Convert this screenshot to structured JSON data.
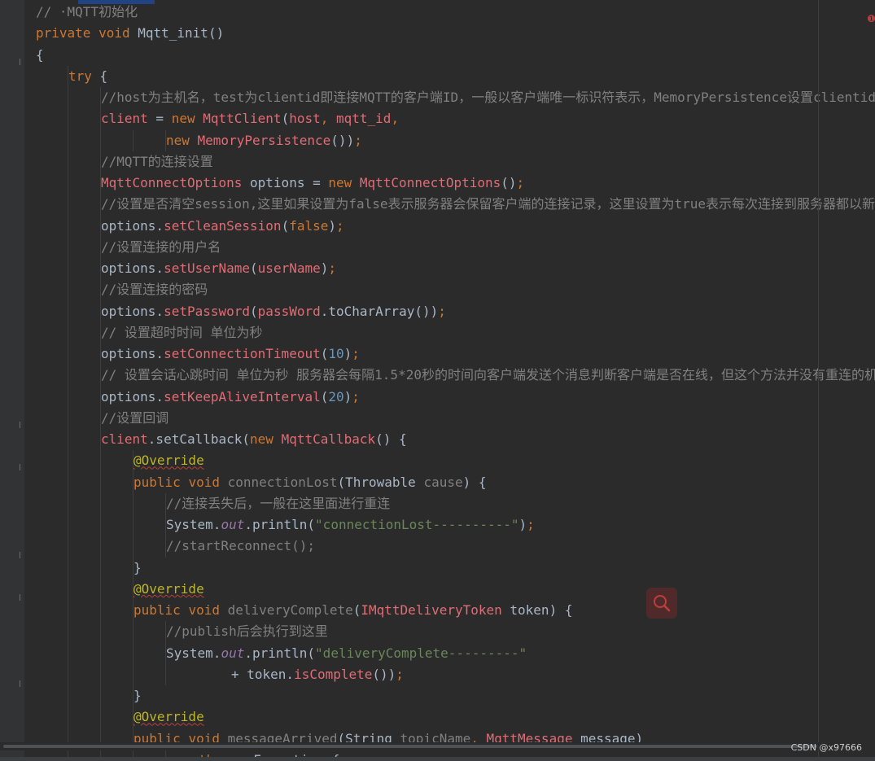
{
  "editor": {
    "lines": [
      {
        "indent": 0,
        "tokens": [
          {
            "t": "// ",
            "c": "comment"
          },
          {
            "t": "·MQTT初始化",
            "c": "comment"
          }
        ]
      },
      {
        "indent": 0,
        "tokens": [
          {
            "t": "private ",
            "c": "kw"
          },
          {
            "t": "void ",
            "c": "kw"
          },
          {
            "t": "Mqtt_init",
            "c": "plain"
          },
          {
            "t": "()",
            "c": "plain"
          }
        ]
      },
      {
        "indent": 0,
        "tokens": [
          {
            "t": "{",
            "c": "plain"
          }
        ]
      },
      {
        "indent": 1,
        "tokens": [
          {
            "t": "try ",
            "c": "kw"
          },
          {
            "t": "{",
            "c": "plain"
          }
        ]
      },
      {
        "indent": 2,
        "tokens": [
          {
            "t": "//host为主机名，test为clientid即连接MQTT的客户端ID，一般以客户端唯一标识符表示，MemoryPersistence设置clientid的保存形式，默认为以内存保存",
            "c": "comment"
          }
        ]
      },
      {
        "indent": 2,
        "tokens": [
          {
            "t": "client",
            "c": "type"
          },
          {
            "t": " = ",
            "c": "plain"
          },
          {
            "t": "new ",
            "c": "kw"
          },
          {
            "t": "MqttClient",
            "c": "type"
          },
          {
            "t": "(",
            "c": "plain"
          },
          {
            "t": "host",
            "c": "type"
          },
          {
            "t": ", ",
            "c": "kw"
          },
          {
            "t": "mqtt_id",
            "c": "type"
          },
          {
            "t": ",",
            "c": "kw"
          }
        ]
      },
      {
        "indent": 4,
        "tokens": [
          {
            "t": "new ",
            "c": "kw"
          },
          {
            "t": "MemoryPersistence",
            "c": "type"
          },
          {
            "t": "())",
            "c": "plain"
          },
          {
            "t": ";",
            "c": "kw"
          }
        ]
      },
      {
        "indent": 2,
        "tokens": [
          {
            "t": "//MQTT的连接设置",
            "c": "comment"
          }
        ]
      },
      {
        "indent": 2,
        "tokens": [
          {
            "t": "MqttConnectOptions",
            "c": "type"
          },
          {
            "t": " options = ",
            "c": "plain"
          },
          {
            "t": "new ",
            "c": "kw"
          },
          {
            "t": "MqttConnectOptions",
            "c": "type"
          },
          {
            "t": "()",
            "c": "plain"
          },
          {
            "t": ";",
            "c": "kw"
          }
        ]
      },
      {
        "indent": 2,
        "tokens": [
          {
            "t": "//设置是否清空session,这里如果设置为false表示服务器会保留客户端的连接记录，这里设置为true表示每次连接到服务器都以新的身份连接",
            "c": "comment"
          }
        ]
      },
      {
        "indent": 2,
        "tokens": [
          {
            "t": "options.",
            "c": "plain"
          },
          {
            "t": "setCleanSession",
            "c": "type"
          },
          {
            "t": "(",
            "c": "plain"
          },
          {
            "t": "false",
            "c": "kw"
          },
          {
            "t": ")",
            "c": "plain"
          },
          {
            "t": ";",
            "c": "kw"
          }
        ]
      },
      {
        "indent": 2,
        "tokens": [
          {
            "t": "//设置连接的用户名",
            "c": "comment"
          }
        ]
      },
      {
        "indent": 2,
        "tokens": [
          {
            "t": "options.",
            "c": "plain"
          },
          {
            "t": "setUserName",
            "c": "type"
          },
          {
            "t": "(",
            "c": "plain"
          },
          {
            "t": "userName",
            "c": "type"
          },
          {
            "t": ")",
            "c": "plain"
          },
          {
            "t": ";",
            "c": "kw"
          }
        ]
      },
      {
        "indent": 2,
        "tokens": [
          {
            "t": "//设置连接的密码",
            "c": "comment"
          }
        ]
      },
      {
        "indent": 2,
        "tokens": [
          {
            "t": "options.",
            "c": "plain"
          },
          {
            "t": "setPassword",
            "c": "type"
          },
          {
            "t": "(",
            "c": "plain"
          },
          {
            "t": "passWord",
            "c": "type"
          },
          {
            "t": ".toCharArray())",
            "c": "plain"
          },
          {
            "t": ";",
            "c": "kw"
          }
        ]
      },
      {
        "indent": 2,
        "tokens": [
          {
            "t": "// 设置超时时间 单位为秒",
            "c": "comment"
          }
        ]
      },
      {
        "indent": 2,
        "tokens": [
          {
            "t": "options.",
            "c": "plain"
          },
          {
            "t": "setConnectionTimeout",
            "c": "type"
          },
          {
            "t": "(",
            "c": "plain"
          },
          {
            "t": "10",
            "c": "number"
          },
          {
            "t": ")",
            "c": "plain"
          },
          {
            "t": ";",
            "c": "kw"
          }
        ]
      },
      {
        "indent": 2,
        "tokens": [
          {
            "t": "// 设置会话心跳时间 单位为秒 服务器会每隔1.5*20秒的时间向客户端发送个消息判断客户端是否在线，但这个方法并没有重连的机制",
            "c": "comment"
          }
        ]
      },
      {
        "indent": 2,
        "tokens": [
          {
            "t": "options.",
            "c": "plain"
          },
          {
            "t": "setKeepAliveInterval",
            "c": "type"
          },
          {
            "t": "(",
            "c": "plain"
          },
          {
            "t": "20",
            "c": "number"
          },
          {
            "t": ")",
            "c": "plain"
          },
          {
            "t": ";",
            "c": "kw"
          }
        ]
      },
      {
        "indent": 2,
        "tokens": [
          {
            "t": "//设置回调",
            "c": "comment"
          }
        ]
      },
      {
        "indent": 2,
        "tokens": [
          {
            "t": "client",
            "c": "type"
          },
          {
            "t": ".setCallback(",
            "c": "plain"
          },
          {
            "t": "new ",
            "c": "kw"
          },
          {
            "t": "MqttCallback",
            "c": "type"
          },
          {
            "t": "() {",
            "c": "plain"
          }
        ]
      },
      {
        "indent": 3,
        "tokens": [
          {
            "t": "@Override",
            "c": "annotation"
          }
        ]
      },
      {
        "indent": 3,
        "tokens": [
          {
            "t": "public ",
            "c": "kw"
          },
          {
            "t": "void ",
            "c": "kw"
          },
          {
            "t": "connectionLost",
            "c": "comment"
          },
          {
            "t": "(Throwable ",
            "c": "plain"
          },
          {
            "t": "cause",
            "c": "comment"
          },
          {
            "t": ") {",
            "c": "plain"
          }
        ]
      },
      {
        "indent": 4,
        "tokens": [
          {
            "t": "//连接丢失后，一般在这里面进行重连",
            "c": "comment"
          }
        ]
      },
      {
        "indent": 4,
        "tokens": [
          {
            "t": "System.",
            "c": "plain"
          },
          {
            "t": "out",
            "c": "italic"
          },
          {
            "t": ".println(",
            "c": "plain"
          },
          {
            "t": "\"connectionLost----------\"",
            "c": "string"
          },
          {
            "t": ")",
            "c": "plain"
          },
          {
            "t": ";",
            "c": "kw"
          }
        ]
      },
      {
        "indent": 4,
        "tokens": [
          {
            "t": "//startReconnect();",
            "c": "comment"
          }
        ]
      },
      {
        "indent": 3,
        "tokens": [
          {
            "t": "}",
            "c": "plain"
          }
        ]
      },
      {
        "indent": 3,
        "tokens": [
          {
            "t": "@Override",
            "c": "annotation"
          }
        ]
      },
      {
        "indent": 3,
        "tokens": [
          {
            "t": "public ",
            "c": "kw"
          },
          {
            "t": "void ",
            "c": "kw"
          },
          {
            "t": "deliveryComplete",
            "c": "comment"
          },
          {
            "t": "(",
            "c": "plain"
          },
          {
            "t": "IMqttDeliveryToken",
            "c": "type"
          },
          {
            "t": " token) {",
            "c": "plain"
          }
        ]
      },
      {
        "indent": 4,
        "tokens": [
          {
            "t": "//publish后会执行到这里",
            "c": "comment"
          }
        ]
      },
      {
        "indent": 4,
        "tokens": [
          {
            "t": "System.",
            "c": "plain"
          },
          {
            "t": "out",
            "c": "italic"
          },
          {
            "t": ".println(",
            "c": "plain"
          },
          {
            "t": "\"deliveryComplete---------\"",
            "c": "string"
          }
        ]
      },
      {
        "indent": 6,
        "tokens": [
          {
            "t": "+ token.",
            "c": "plain"
          },
          {
            "t": "isComplete",
            "c": "type"
          },
          {
            "t": "())",
            "c": "plain"
          },
          {
            "t": ";",
            "c": "kw"
          }
        ]
      },
      {
        "indent": 3,
        "tokens": [
          {
            "t": "}",
            "c": "plain"
          }
        ]
      },
      {
        "indent": 3,
        "tokens": [
          {
            "t": "@Override",
            "c": "annotation"
          }
        ]
      },
      {
        "indent": 3,
        "tokens": [
          {
            "t": "public ",
            "c": "kw"
          },
          {
            "t": "void ",
            "c": "kw"
          },
          {
            "t": "messageArrived",
            "c": "comment"
          },
          {
            "t": "(String ",
            "c": "plain"
          },
          {
            "t": "topicName",
            "c": "comment"
          },
          {
            "t": ", ",
            "c": "kw"
          },
          {
            "t": "MqttMessage",
            "c": "type"
          },
          {
            "t": " message)",
            "c": "plain"
          }
        ]
      },
      {
        "indent": 5,
        "tokens": [
          {
            "t": "throws ",
            "c": "kw"
          },
          {
            "t": "Exception ",
            "c": "plain"
          },
          {
            "t": "{",
            "c": "plain"
          }
        ]
      }
    ]
  },
  "watermark": "CSDN @x97666",
  "icons": {
    "search": "search-icon",
    "error": "error-indicator-icon"
  }
}
